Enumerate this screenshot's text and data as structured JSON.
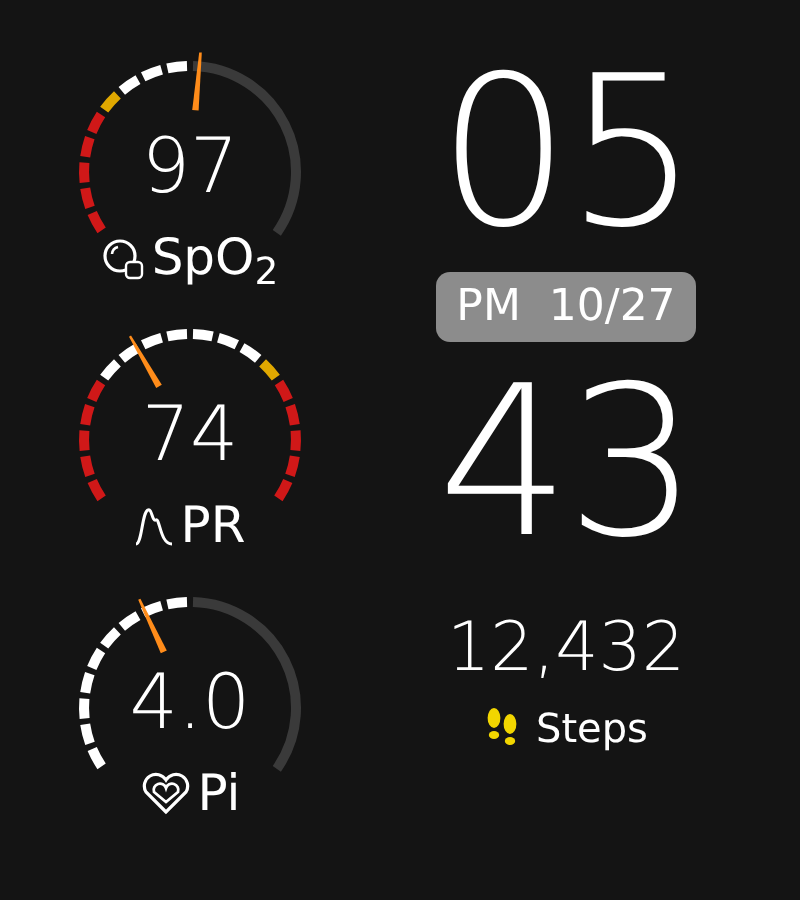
{
  "gauges": [
    {
      "kind": "spo2",
      "value": "97",
      "label": "SpO$_{2}$",
      "segments": [
        {
          "color": "#d01818"
        },
        {
          "color": "#d01818"
        },
        {
          "color": "#d01818"
        },
        {
          "color": "#d01818"
        },
        {
          "color": "#d01818"
        },
        {
          "color": "#e0a800"
        },
        {
          "color": "#ffffff"
        },
        {
          "color": "#ffffff"
        },
        {
          "color": "#ffffff"
        }
      ]
    },
    {
      "kind": "pr",
      "value": "74",
      "label": "PR",
      "segments": [
        {
          "color": "#d01818"
        },
        {
          "color": "#d01818"
        },
        {
          "color": "#d01818"
        },
        {
          "color": "#d01818"
        },
        {
          "color": "#d01818"
        },
        {
          "color": "#ffffff"
        },
        {
          "color": "#ffffff"
        },
        {
          "color": "#ffffff"
        },
        {
          "color": "#ffffff"
        },
        {
          "color": "#ffffff"
        },
        {
          "color": "#ffffff"
        },
        {
          "color": "#ffffff"
        },
        {
          "color": "#e0a800"
        },
        {
          "color": "#d01818"
        },
        {
          "color": "#d01818"
        },
        {
          "color": "#d01818"
        },
        {
          "color": "#d01818"
        },
        {
          "color": "#d01818"
        }
      ]
    },
    {
      "kind": "pi",
      "value": "4.0",
      "label": "Pi",
      "segments": [
        {
          "color": "#ffffff"
        },
        {
          "color": "#ffffff"
        },
        {
          "color": "#ffffff"
        },
        {
          "color": "#ffffff"
        },
        {
          "color": "#ffffff"
        },
        {
          "color": "#ffffff"
        },
        {
          "color": "#ffffff"
        },
        {
          "color": "#ffffff"
        },
        {
          "color": "#ffffff"
        }
      ]
    }
  ],
  "clock": {
    "hour": "05",
    "date": "PM  10/27",
    "minute": "43"
  },
  "steps": {
    "count": "12,432",
    "label": "Steps"
  }
}
